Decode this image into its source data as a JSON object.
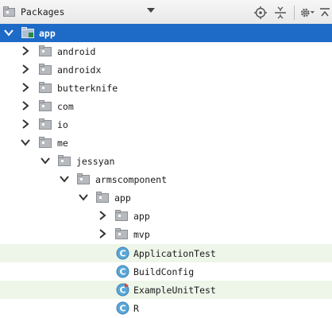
{
  "toolbar": {
    "view_title": "Packages",
    "icons": [
      "package-icon",
      "chevron-down-icon",
      "locate-icon",
      "collapse-all-icon",
      "gear-icon",
      "hide-panel-icon"
    ]
  },
  "tree": {
    "root": {
      "label": "app",
      "expanded": true,
      "selected": true
    },
    "nodes": [
      {
        "label": "android",
        "kind": "package",
        "expanded": false
      },
      {
        "label": "androidx",
        "kind": "package",
        "expanded": false
      },
      {
        "label": "butterknife",
        "kind": "package",
        "expanded": false
      },
      {
        "label": "com",
        "kind": "package",
        "expanded": false
      },
      {
        "label": "io",
        "kind": "package",
        "expanded": false
      },
      {
        "label": "me",
        "kind": "package",
        "expanded": true
      },
      {
        "label": "jessyan",
        "kind": "package",
        "expanded": true
      },
      {
        "label": "armscomponent",
        "kind": "package",
        "expanded": true
      },
      {
        "label": "app",
        "kind": "package",
        "expanded": true
      },
      {
        "label": "app",
        "kind": "package",
        "expanded": false
      },
      {
        "label": "mvp",
        "kind": "package",
        "expanded": false
      },
      {
        "label": "ApplicationTest",
        "kind": "class",
        "highlighted": true
      },
      {
        "label": "BuildConfig",
        "kind": "class"
      },
      {
        "label": "ExampleUnitTest",
        "kind": "class",
        "highlighted": true,
        "test_marker": true
      },
      {
        "label": "R",
        "kind": "class"
      }
    ]
  },
  "colors": {
    "selection": "#1e6ac7",
    "highlight_row": "#eef5e9",
    "folder": "#a9adb3",
    "class_icon": "#5aa7d8"
  }
}
